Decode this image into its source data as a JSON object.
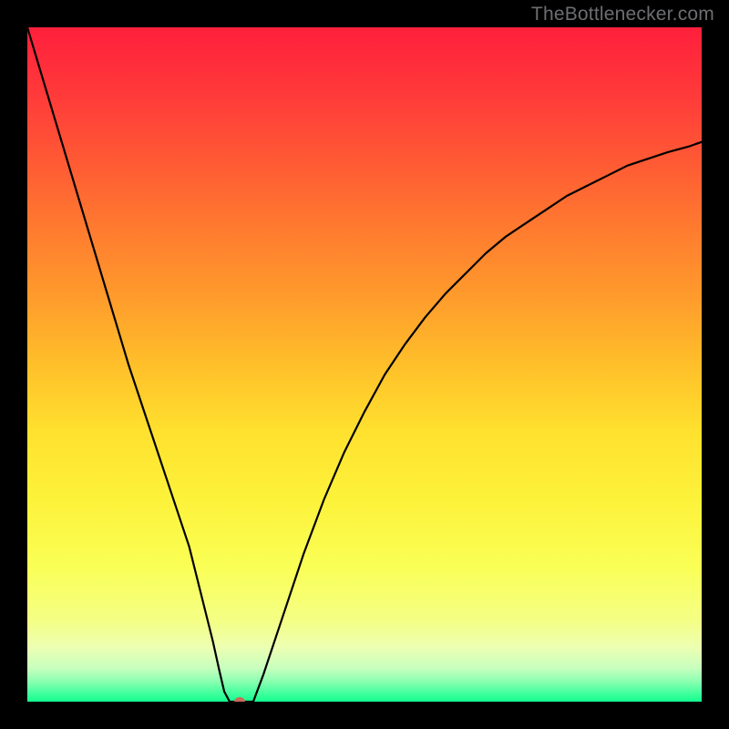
{
  "watermark": "TheBottlenecker.com",
  "chart_data": {
    "type": "line",
    "title": "",
    "xlabel": "",
    "ylabel": "",
    "xlim": [
      0,
      100
    ],
    "ylim": [
      0,
      100
    ],
    "x": [
      0,
      3,
      6,
      9,
      12,
      15,
      18,
      21,
      24,
      26,
      27.5,
      28.5,
      29.2,
      30,
      31,
      33.5,
      35,
      38,
      41,
      44,
      47,
      50,
      53,
      56,
      59,
      62,
      65,
      68,
      71,
      74,
      77,
      80,
      83,
      86,
      89,
      92,
      95,
      98,
      100
    ],
    "values": [
      100,
      90,
      80,
      70,
      60,
      50,
      41,
      32,
      23,
      15,
      9,
      4.5,
      1.5,
      0,
      0,
      0,
      4,
      13,
      22,
      30,
      37,
      43,
      48.5,
      53,
      57,
      60.5,
      63.5,
      66.5,
      69,
      71,
      73,
      75,
      76.5,
      78,
      79.5,
      80.5,
      81.5,
      82.3,
      83
    ],
    "marker": {
      "x": 31.5,
      "y": 0
    },
    "background": {
      "type": "vertical-gradient",
      "stops": [
        {
          "pos": 0.0,
          "color": "#ff1f3c"
        },
        {
          "pos": 0.5,
          "color": "#ffbf2a"
        },
        {
          "pos": 0.8,
          "color": "#faff56"
        },
        {
          "pos": 1.0,
          "color": "#13ff8f"
        }
      ]
    }
  }
}
